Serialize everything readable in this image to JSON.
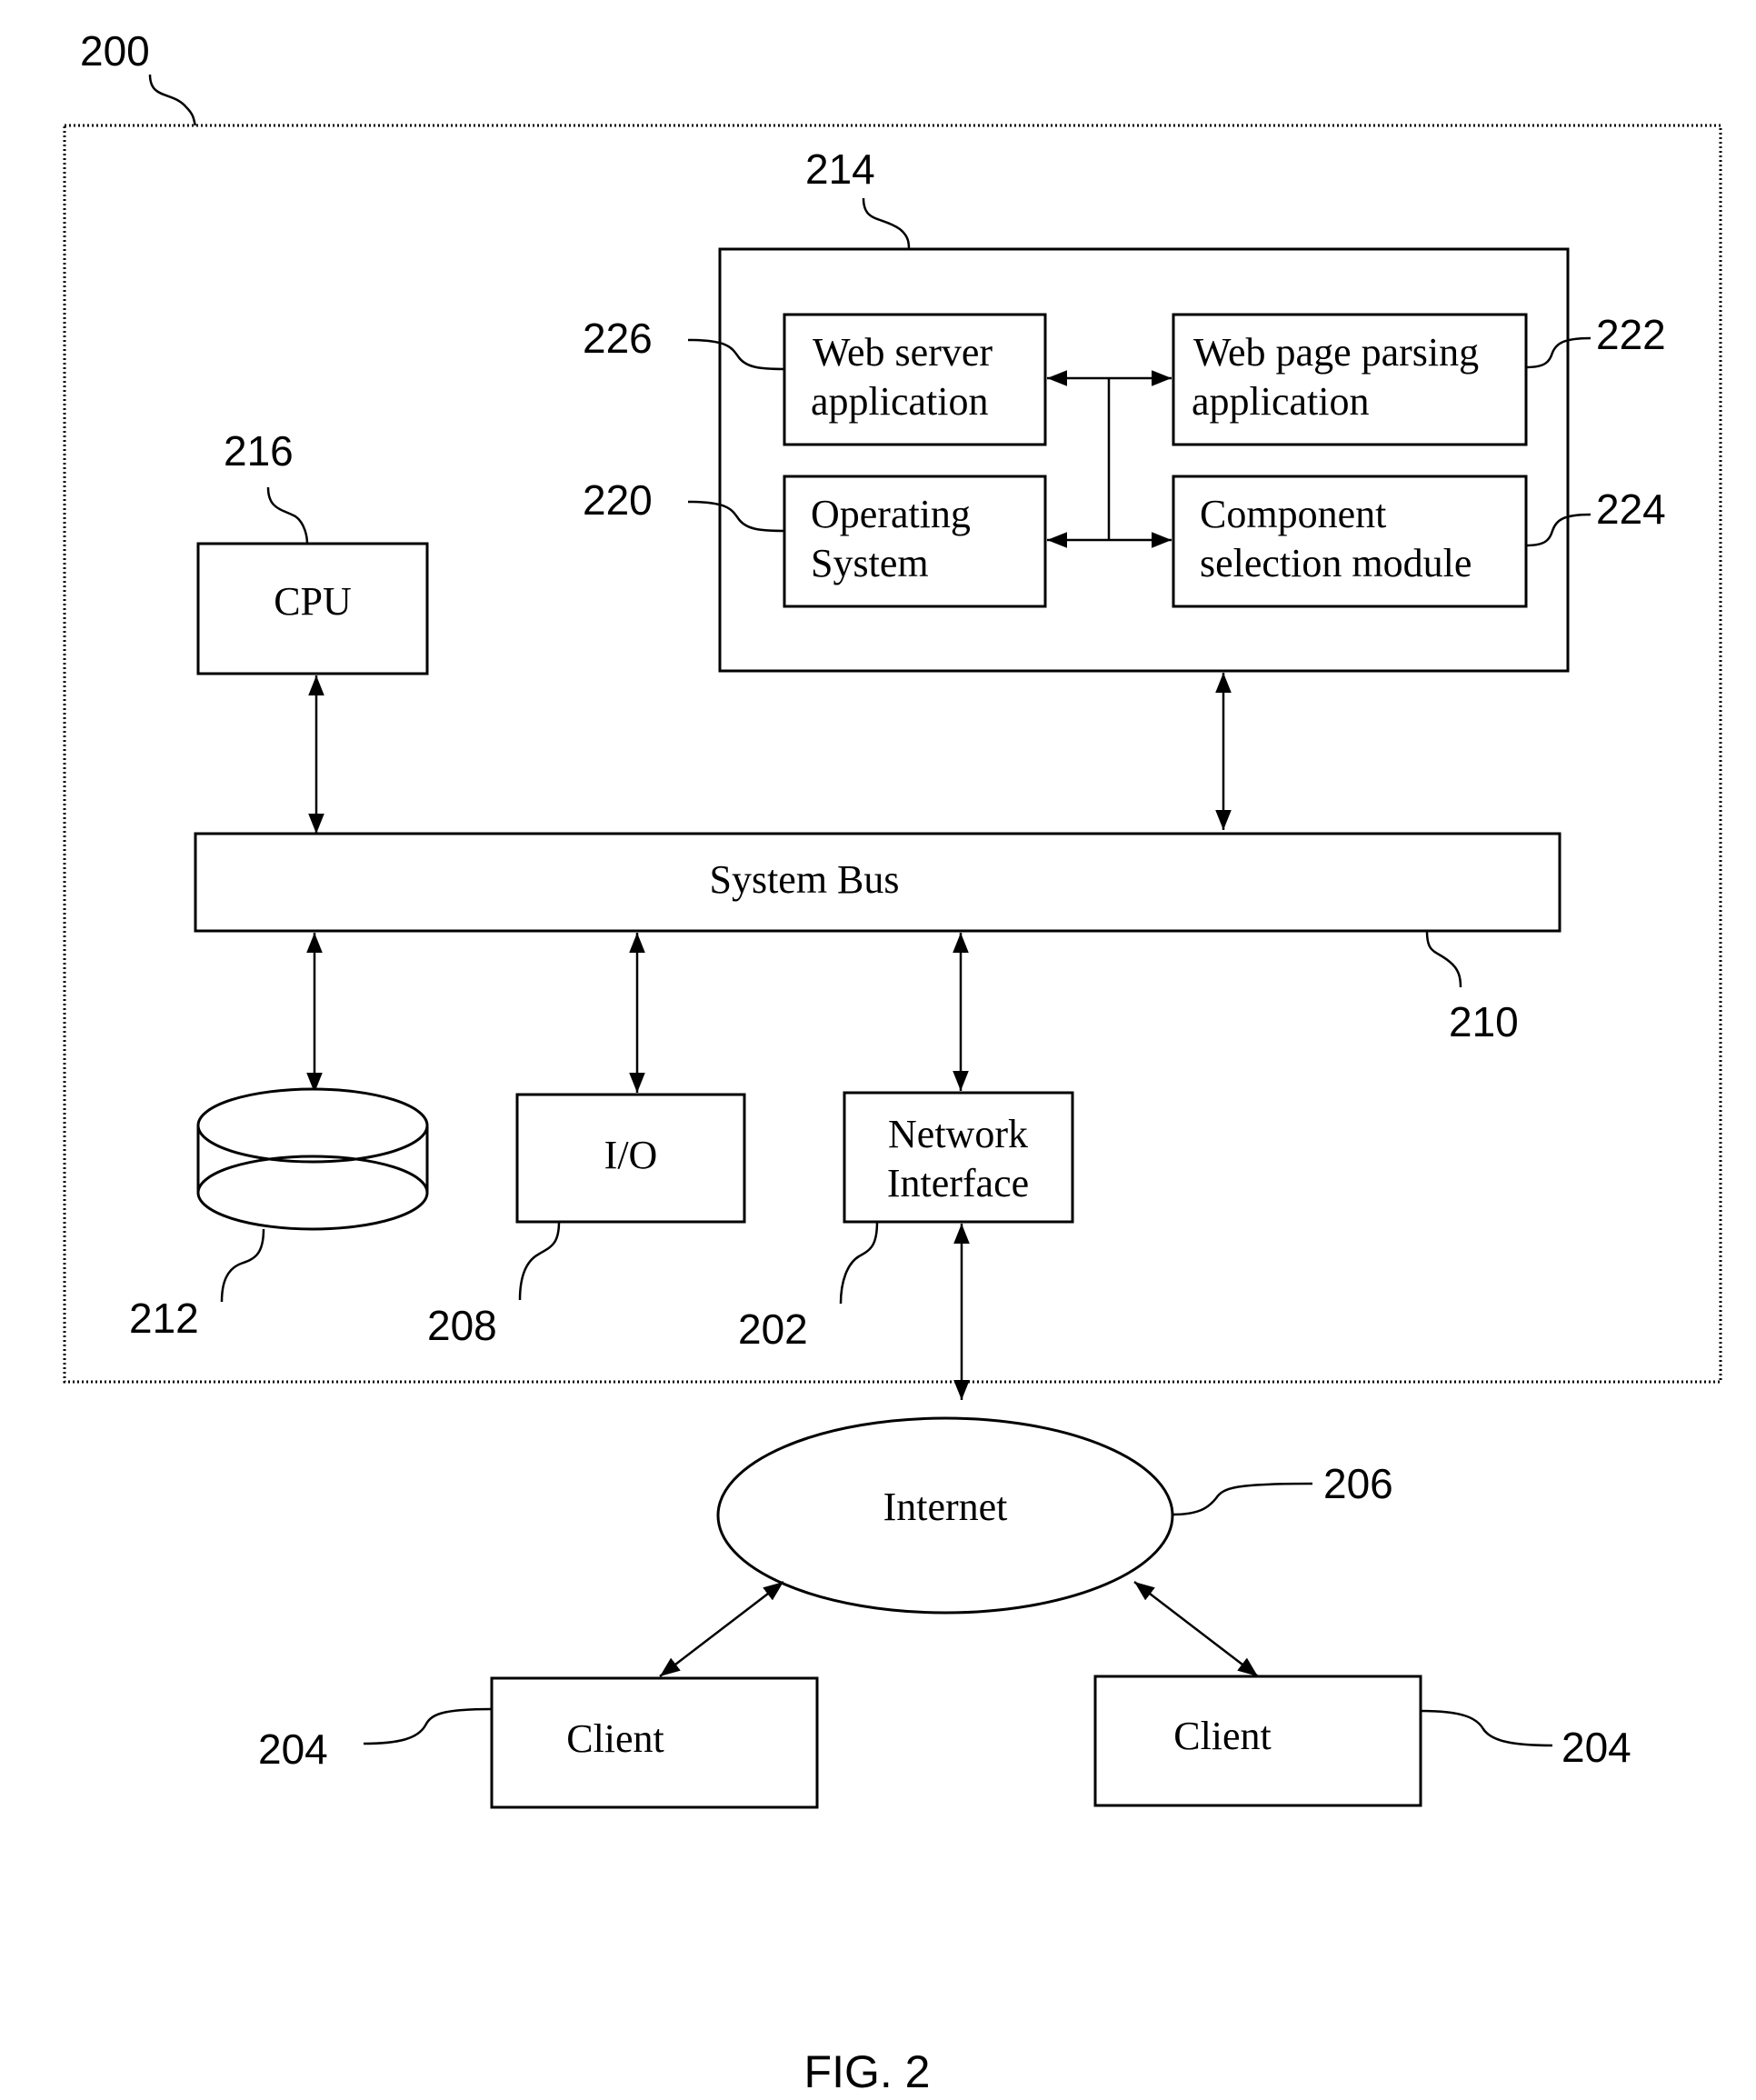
{
  "figure": {
    "caption": "FIG. 2",
    "system_ref": "200"
  },
  "memory": {
    "ref": "214",
    "modules": {
      "web_server": {
        "ref": "226",
        "lines": [
          "Web server",
          "application"
        ]
      },
      "web_page_parsing": {
        "ref": "222",
        "lines": [
          "Web page parsing",
          "application"
        ]
      },
      "operating_system": {
        "ref": "220",
        "lines": [
          "Operating",
          "System"
        ]
      },
      "component_selection": {
        "ref": "224",
        "lines": [
          "Component",
          "selection module"
        ]
      }
    }
  },
  "cpu": {
    "ref": "216",
    "label": "CPU"
  },
  "system_bus": {
    "ref": "210",
    "label": "System Bus"
  },
  "storage": {
    "ref": "212"
  },
  "io": {
    "ref": "208",
    "label": "I/O"
  },
  "network_interface": {
    "ref": "202",
    "lines": [
      "Network",
      "Interface"
    ]
  },
  "internet": {
    "ref": "206",
    "label": "Internet"
  },
  "clients": [
    {
      "ref": "204",
      "label": "Client"
    },
    {
      "ref": "204",
      "label": "Client"
    }
  ]
}
